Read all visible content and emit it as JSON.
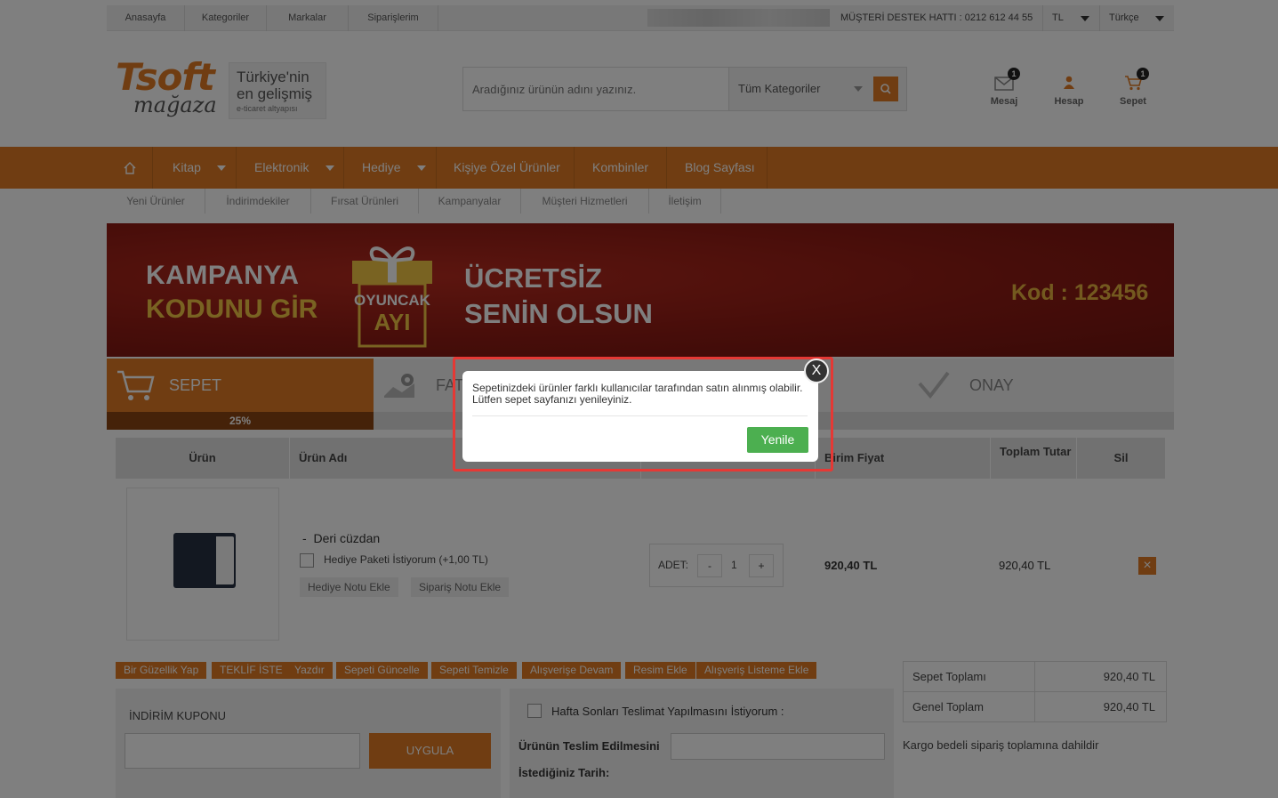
{
  "topbar": {
    "links": [
      "Anasayfa",
      "Kategoriler",
      "Markalar",
      "Siparişlerim"
    ],
    "hotline": "MÜŞTERİ DESTEK HATTI : 0212 612 44 55",
    "currency": "TL",
    "language": "Türkçe"
  },
  "logo": {
    "brand": "Tsoft",
    "sub": "mağaza",
    "tag1": "Türkiye'nin",
    "tag2": "en gelişmiş",
    "tag3": "e-ticaret altyapısı"
  },
  "search": {
    "placeholder": "Aradığınız ürünün adını yazınız.",
    "category": "Tüm Kategoriler"
  },
  "header_icons": {
    "message": {
      "label": "Mesaj",
      "count": "1"
    },
    "account": {
      "label": "Hesap"
    },
    "cart": {
      "label": "Sepet",
      "count": "1"
    }
  },
  "nav": [
    "Kitap",
    "Elektronik",
    "Hediye",
    "Kişiye Özel Ürünler",
    "Kombinler",
    "Blog Sayfası"
  ],
  "subnav": [
    "Yeni Ürünler",
    "İndirimdekiler",
    "Fırsat Ürünleri",
    "Kampanyalar",
    "Müşteri Hizmetleri",
    "İletişim"
  ],
  "banner": {
    "line1": "KAMPANYA",
    "line2": "KODUNU GİR",
    "gift1": "OYUNCAK",
    "gift2": "AYI",
    "line3": "ÜCRETSİZ",
    "line4": "SENİN OLSUN",
    "code_label": "Kod : ",
    "code": "123456"
  },
  "steps": {
    "step1": "SEPET",
    "step2": "FATURA",
    "step4": "ONAY",
    "progress": "25%"
  },
  "table": {
    "headers": [
      "Ürün",
      "Ürün Adı",
      "",
      "Birim Fiyat",
      "Toplam Tutar",
      "Sil"
    ],
    "row": {
      "name": "Deri cüzdan",
      "gift_option": "Hediye Paketi İstiyorum (+1,00 TL)",
      "gift_note": "Hediye Notu Ekle",
      "order_note": "Sipariş Notu Ekle",
      "qty_label": "ADET:",
      "qty": "1",
      "unit_price": "920,40 TL",
      "total": "920,40 TL"
    }
  },
  "actions": [
    "Bir Güzellik Yap",
    "TEKLİF İSTE",
    "Yazdır",
    "Sepeti Güncelle",
    "Sepeti Temizle",
    "Alışverişe Devam",
    "Resim Ekle",
    "Alışveriş Listeme Ekle"
  ],
  "coupon": {
    "label": "İNDİRİM KUPONU",
    "button": "UYGULA"
  },
  "delivery": {
    "weekend": "Hafta Sonları Teslimat Yapılmasını İstiyorum :",
    "date_label1": "Ürünün Teslim Edilmesini",
    "date_label2": "İstediğiniz Tarih:"
  },
  "summary": {
    "subtotal_label": "Sepet Toplamı",
    "subtotal": "920,40 TL",
    "total_label": "Genel Toplam",
    "total": "920,40 TL",
    "shipping_note": "Kargo bedeli sipariş toplamına dahildir"
  },
  "modal": {
    "message": "Sepetinizdeki ürünler farklı kullanıcılar tarafından satın alınmış olabilir. Lütfen sepet sayfanızı yenileyiniz.",
    "button": "Yenile",
    "close": "X"
  },
  "colors": {
    "accent": "#e07b24",
    "confirm": "#4caf50",
    "highlight": "#e53935"
  }
}
